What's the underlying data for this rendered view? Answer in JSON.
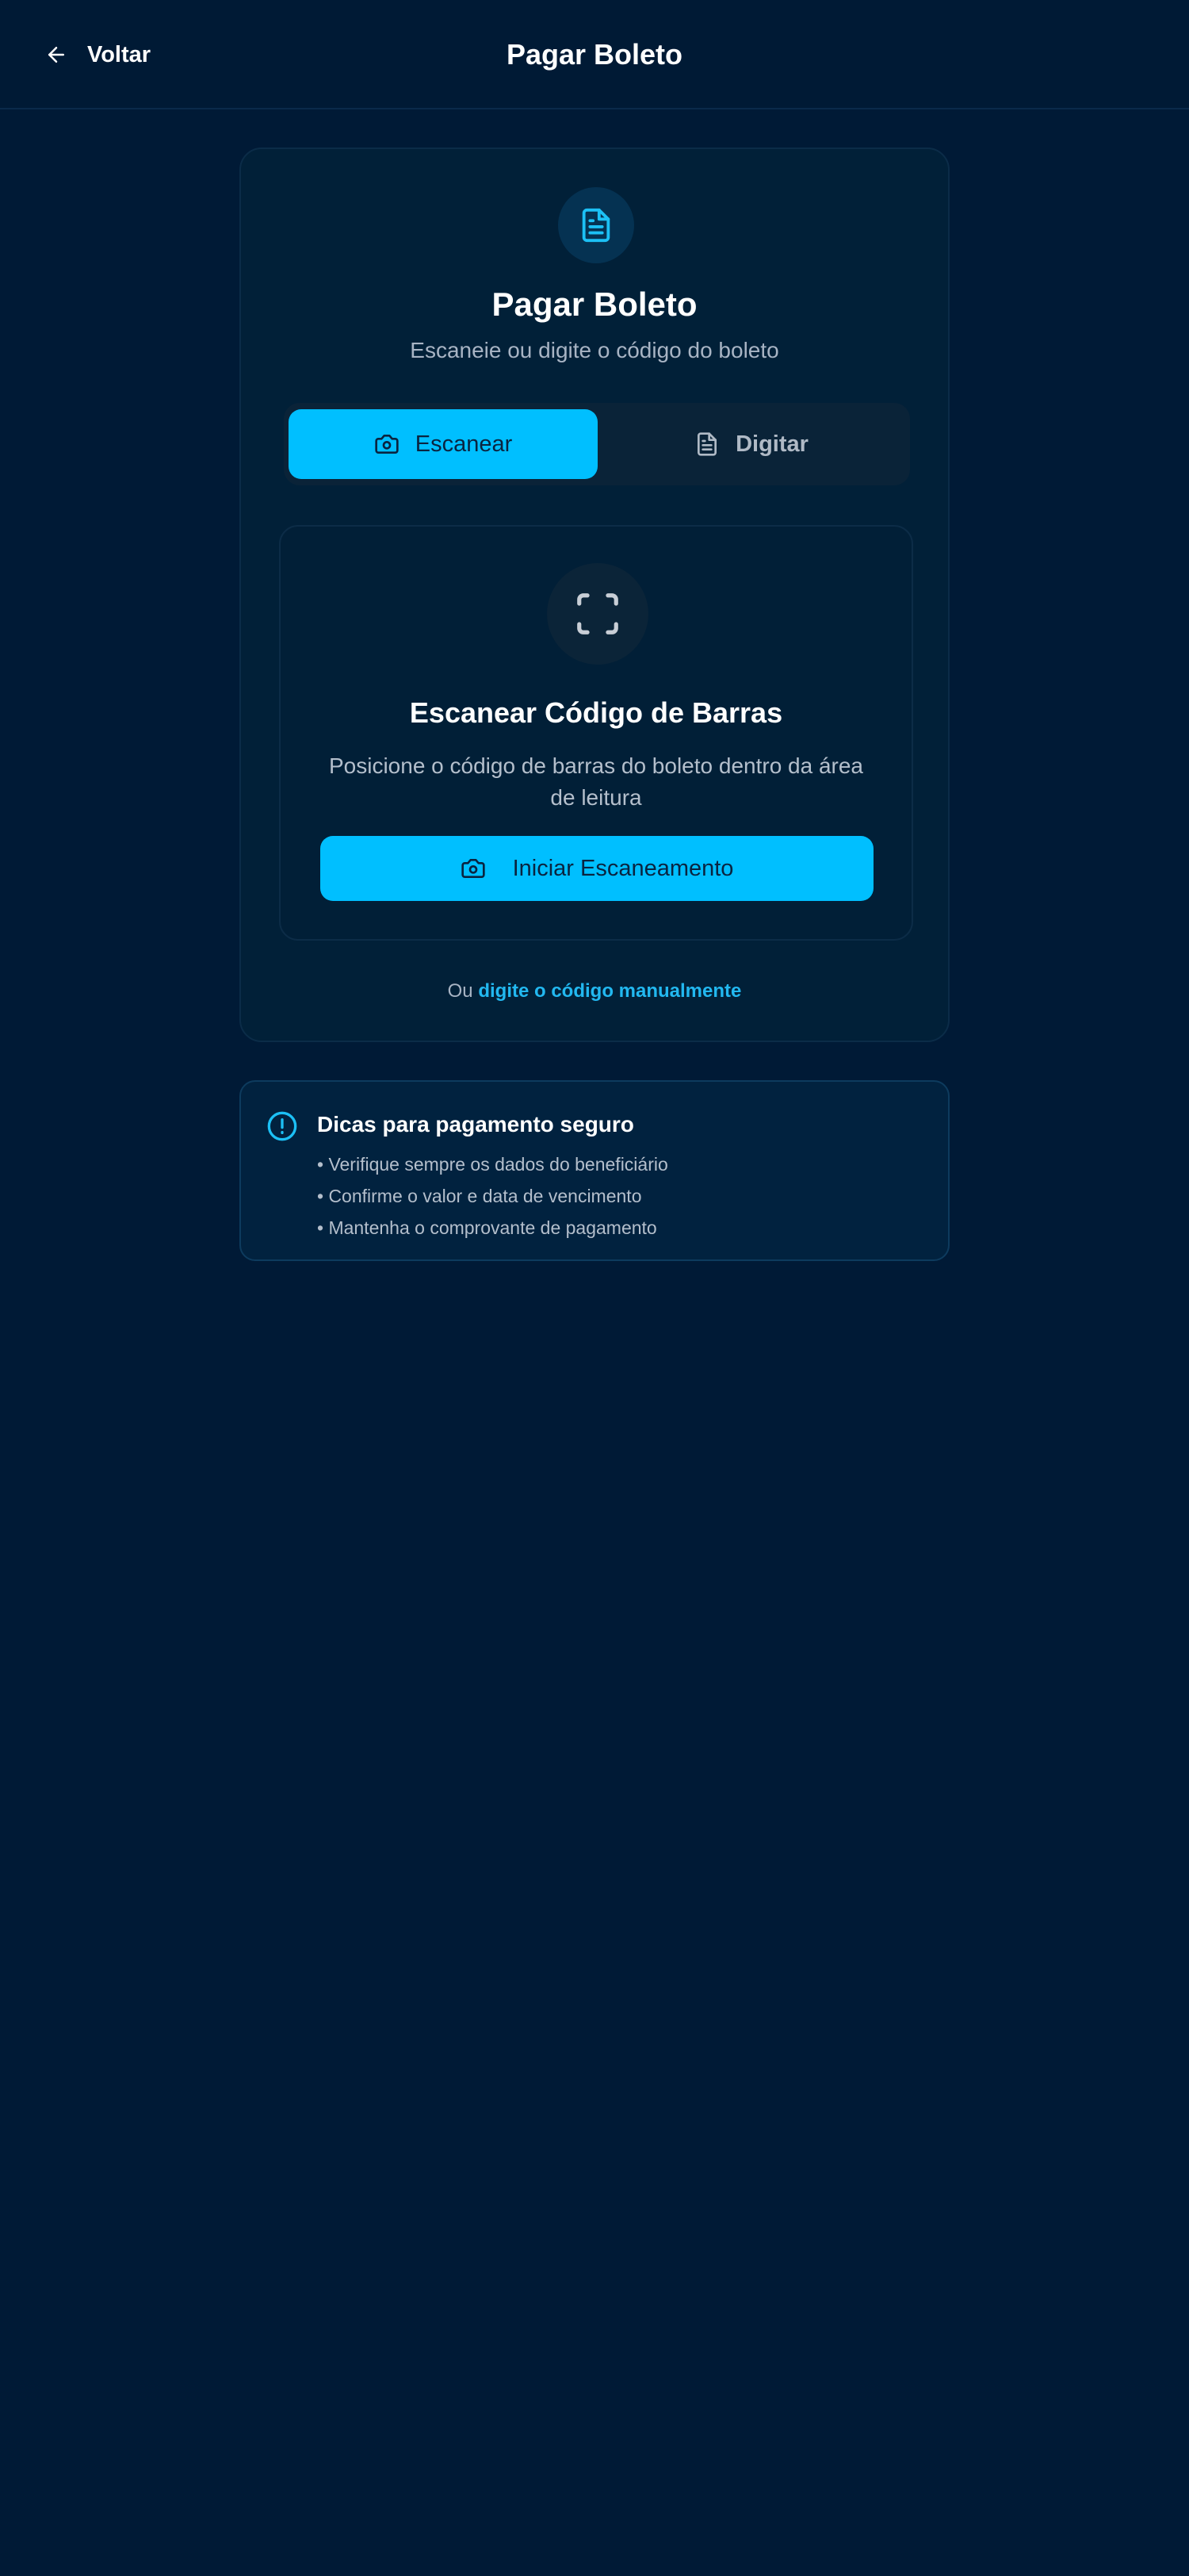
{
  "header": {
    "back_label": "Voltar",
    "title": "Pagar Boleto"
  },
  "card": {
    "icon": "document-icon",
    "title": "Pagar Boleto",
    "subtitle": "Escaneie ou digite o código do boleto",
    "tabs": [
      {
        "label": "Escanear",
        "icon": "camera-icon",
        "active": true
      },
      {
        "label": "Digitar",
        "icon": "document-icon",
        "active": false
      }
    ],
    "scanner": {
      "icon": "scan-frame-icon",
      "title": "Escanear Código de Barras",
      "description": "Posicione o código de barras do boleto dentro da área de leitura",
      "button_label": "Iniciar Escaneamento",
      "button_icon": "camera-icon"
    },
    "manual": {
      "prefix": "Ou",
      "link_label": "digite o código manualmente"
    }
  },
  "tips": {
    "icon": "alert-circle-icon",
    "title": "Dicas para pagamento seguro",
    "items": [
      "• Verifique sempre os dados do beneficiário",
      "• Confirme o valor e data de vencimento",
      "• Mantenha o comprovante de pagamento"
    ]
  },
  "colors": {
    "background": "#001a36",
    "accent": "#00bfff",
    "link": "#22b8f0",
    "card": "#012038"
  }
}
